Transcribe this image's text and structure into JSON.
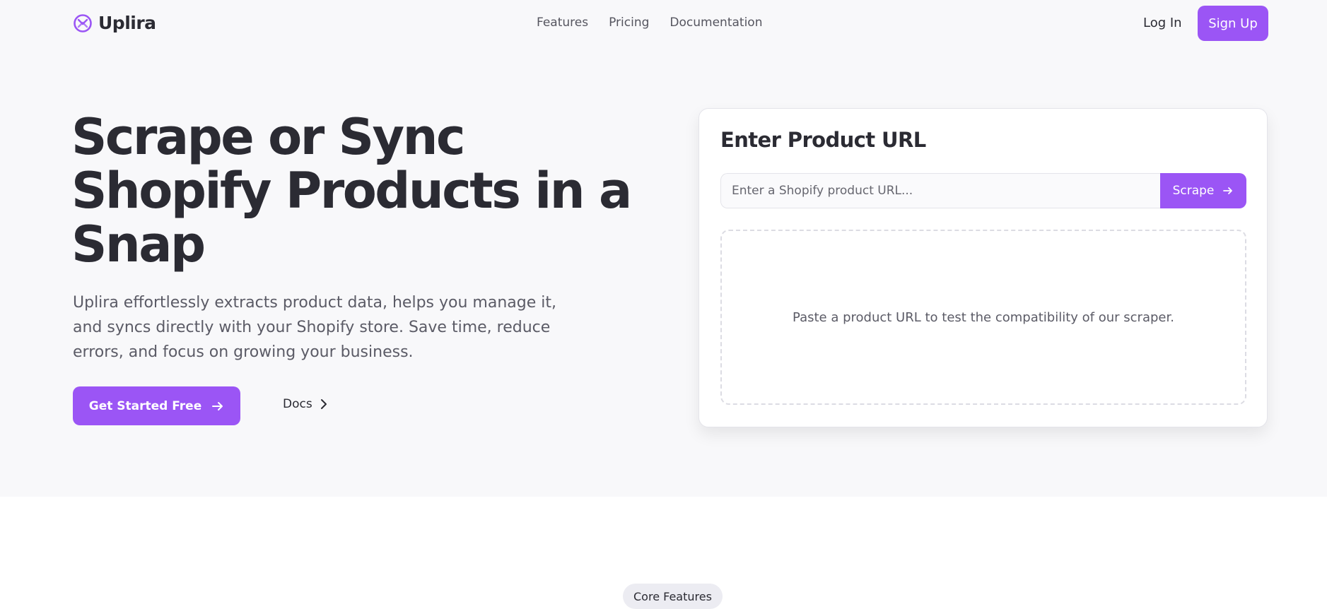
{
  "brand": {
    "name": "Uplira",
    "accent": "#9b55f5"
  },
  "nav": {
    "items": [
      "Features",
      "Pricing",
      "Documentation"
    ]
  },
  "auth": {
    "login": "Log In",
    "signup": "Sign Up"
  },
  "hero": {
    "title": "Scrape or Sync Shopify Products in a Snap",
    "subtitle": "Uplira effortlessly extracts product data, helps you manage it, and syncs directly with your Shopify store. Save time, reduce errors, and focus on growing your business.",
    "cta": "Get Started Free",
    "docs": "Docs"
  },
  "card": {
    "title": "Enter Product URL",
    "input_placeholder": "Enter a Shopify product URL...",
    "input_value": "",
    "scrape": "Scrape",
    "empty_message": "Paste a product URL to test the compatibility of our scraper."
  },
  "features": {
    "pill": "Core Features"
  },
  "icons": {
    "logo": "uplira-logo-icon",
    "cta_arrow": "arrow-right-icon",
    "docs_chevron": "chevron-right-icon",
    "scrape_arrow": "arrow-right-icon"
  }
}
